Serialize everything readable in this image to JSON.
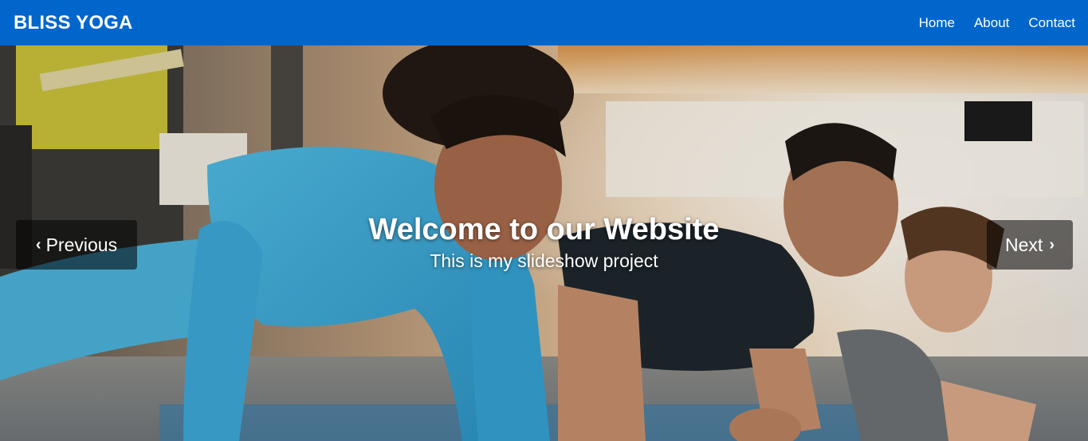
{
  "navbar": {
    "brand": "BLISS YOGA",
    "links": [
      {
        "label": "Home"
      },
      {
        "label": "About"
      },
      {
        "label": "Contact"
      }
    ],
    "color": "#0066cc"
  },
  "slideshow": {
    "title": "Welcome to our Website",
    "subtitle": "This is my slideshow project",
    "prev_label": "Previous",
    "next_label": "Next",
    "prev_icon": "‹",
    "next_icon": "›",
    "image_subject": "people doing plank exercise in gym"
  }
}
